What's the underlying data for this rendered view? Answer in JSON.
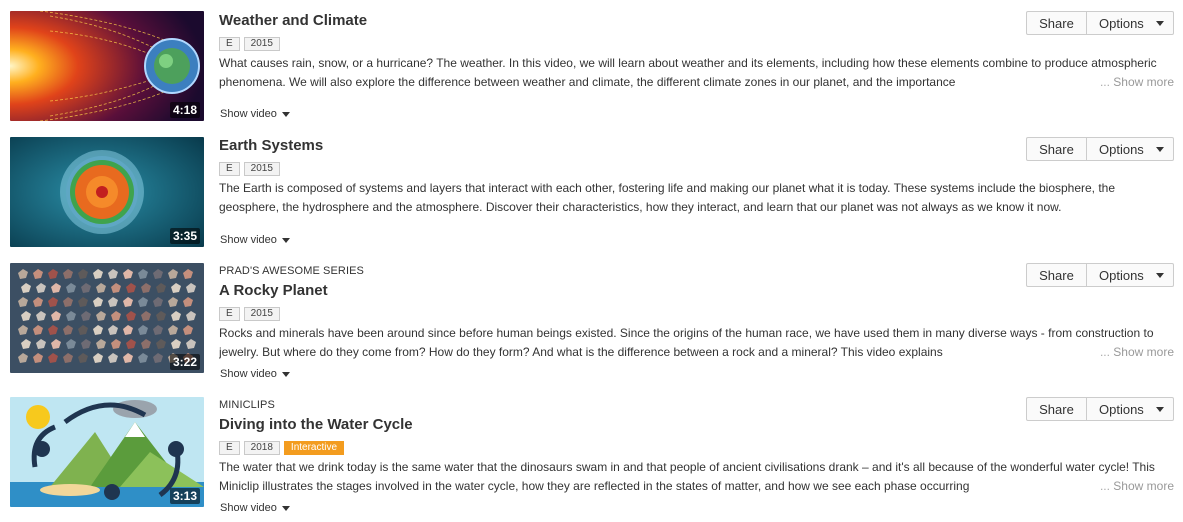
{
  "items": [
    {
      "series": "",
      "title": "Weather and Climate",
      "grade": "E",
      "year": "2015",
      "badge": "",
      "duration": "4:18",
      "description": "What causes rain, snow, or a hurricane? The weather. In this video, we will learn about weather and its elements, including how these elements combine to produce atmospheric phenomena. We will also explore the difference between weather and climate, the different climate zones in our planet, and the importance",
      "truncated": true
    },
    {
      "series": "",
      "title": "Earth Systems",
      "grade": "E",
      "year": "2015",
      "badge": "",
      "duration": "3:35",
      "description": "The Earth is composed of systems and layers that interact with each other, fostering life and making our planet what it is today. These systems include the biosphere, the geosphere, the hydrosphere and the atmosphere. Discover their characteristics, how they interact, and learn that our planet was not always as we know it now.",
      "truncated": false
    },
    {
      "series": "PRAD'S AWESOME SERIES",
      "title": "A Rocky Planet",
      "grade": "E",
      "year": "2015",
      "badge": "",
      "duration": "3:22",
      "description": "Rocks and minerals have been around since before human beings existed. Since the origins of the human race, we have used them in many diverse ways - from construction to jewelry. But where do they come from? How do they form? And what is the difference between a rock and a mineral? This video explains",
      "truncated": true
    },
    {
      "series": "MINICLIPS",
      "title": "Diving into the Water Cycle",
      "grade": "E",
      "year": "2018",
      "badge": "Interactive",
      "duration": "3:13",
      "description": "The water that we drink today is the same water that the dinosaurs swam in and that people of ancient civilisations drank – and it's all because of the wonderful water cycle! This Miniclip illustrates the stages involved in the water cycle, how they are reflected in the states of matter, and how we see each phase occurring",
      "truncated": true
    }
  ],
  "labels": {
    "share": "Share",
    "options": "Options",
    "show_video": "Show video",
    "show_more": "Show more",
    "ellipsis": "..."
  },
  "colors": {
    "badge_interactive": "#f39c1f",
    "show_more": "#999999"
  }
}
